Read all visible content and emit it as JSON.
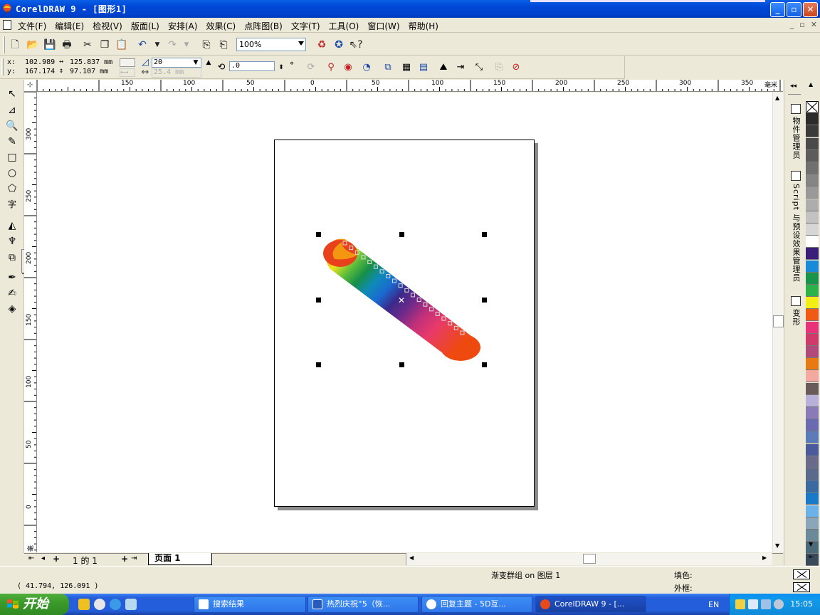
{
  "window": {
    "title": "CorelDRAW 9 - [图形1]",
    "minimize": "_",
    "maximize": "▫",
    "close": "✕"
  },
  "menu": {
    "items": [
      "文件(F)",
      "编辑(E)",
      "检视(V)",
      "版面(L)",
      "安排(A)",
      "效果(C)",
      "点阵图(B)",
      "文字(T)",
      "工具(O)",
      "窗口(W)",
      "帮助(H)"
    ],
    "mdi": [
      "_",
      "▫",
      "✕"
    ]
  },
  "toolbar": {
    "zoom_value": "100%"
  },
  "property_bar": {
    "x_label": "x:",
    "y_label": "y:",
    "x_value": "102.989",
    "y_value": "167.174",
    "width_value": "125.837 mm",
    "height_value": "97.107 mm",
    "steps_value": "20",
    "spacing_value": "25.4 mm",
    "angle_value": ".0",
    "degree_symbol": "°"
  },
  "ruler": {
    "h_labels": [
      "150",
      "100",
      "50",
      "0",
      "50",
      "100",
      "150",
      "200",
      "250",
      "300",
      "350"
    ],
    "h_unit": "毫米",
    "v_labels": [
      "300",
      "250",
      "200",
      "150",
      "100",
      "50",
      "0"
    ],
    "v_unit": "毫米"
  },
  "page_nav": {
    "counter": "1 的 1",
    "page_tab": "页面  1"
  },
  "docker": {
    "tabs": [
      "物件管理员",
      "Script 与预设效果管理员",
      "变形"
    ]
  },
  "palette": {
    "colors": [
      "#ffffff",
      "#2b2b2b",
      "#3a3a3a",
      "#4a4a4a",
      "#5c5c5c",
      "#707070",
      "#858585",
      "#999999",
      "#adadad",
      "#c2c2c2",
      "#d6d6d6",
      "#ffffff",
      "#3a1f7a",
      "#1a8ad8",
      "#18954a",
      "#2db24a",
      "#f5ee12",
      "#ef5a14",
      "#e8327a",
      "#d03a6a",
      "#b04a7a",
      "#e87a14",
      "#f3a8a0",
      "#6a5a5a",
      "#b8b0d8",
      "#8a7ab8",
      "#6a6ab0",
      "#5a7ab8",
      "#4a5a9a",
      "#6a6a8a",
      "#5a6a8a",
      "#3a6aa0",
      "#1a7ac8",
      "#6ab2e8",
      "#8aa6b8",
      "#6a8a9a",
      "#4a6a7a",
      "#3a4a5a",
      "#4a5a5a"
    ]
  },
  "status": {
    "object_info": "渐变群组 on 图层 1",
    "fill_label": "填色:",
    "outline_label": "外框:",
    "coordinates": "( 41.794, 126.091 )"
  },
  "taskbar": {
    "start_label": "开始",
    "tasks": [
      "搜索结果",
      "热烈庆祝“5（恢...",
      "回复主题 - 5D互...",
      "CorelDRAW 9 - [..."
    ],
    "lang": "EN",
    "time": "15:05"
  }
}
